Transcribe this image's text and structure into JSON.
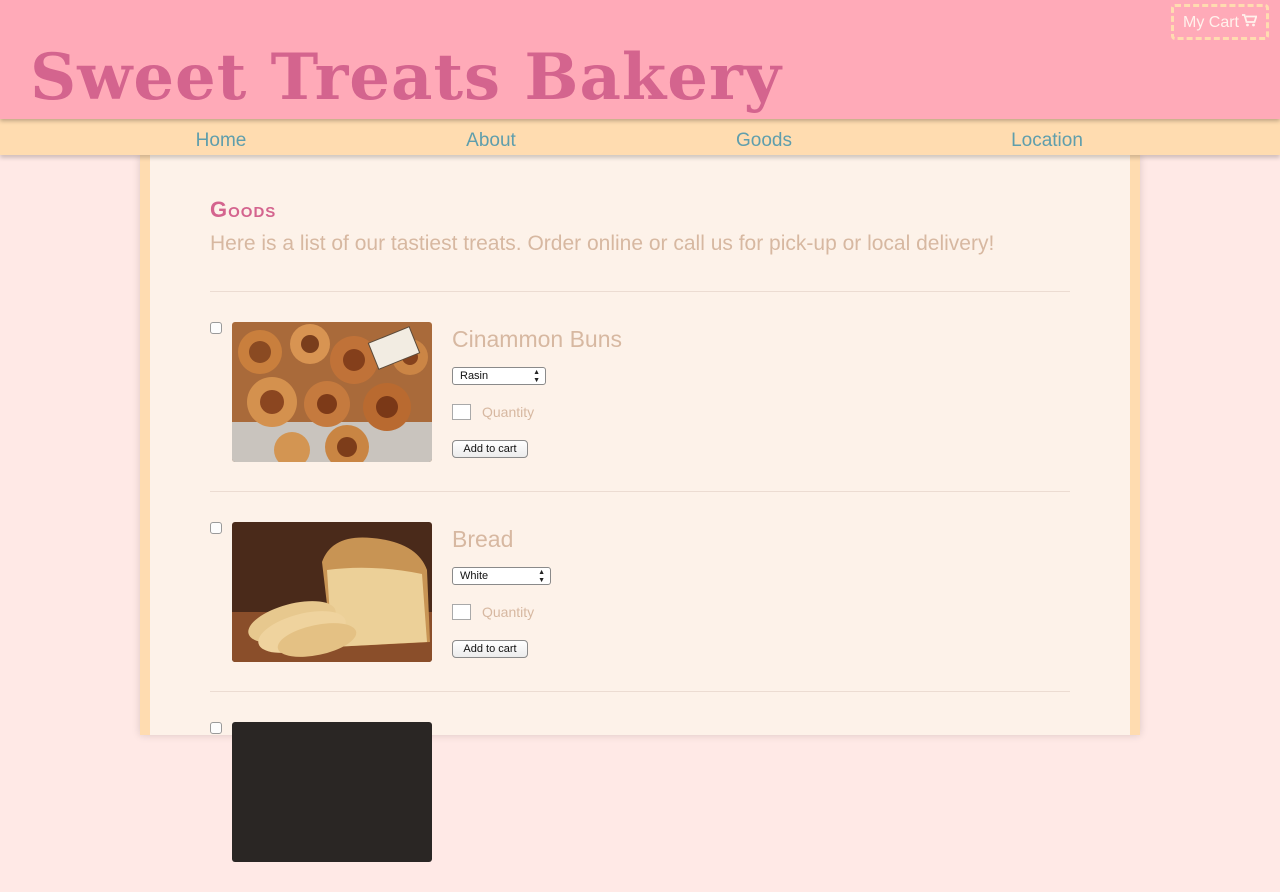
{
  "header": {
    "title": "Sweet Treats Bakery",
    "cart_label": "My Cart",
    "cart_icon": "shopping-cart-icon"
  },
  "nav": {
    "items": [
      {
        "label": "Home"
      },
      {
        "label": "About"
      },
      {
        "label": "Goods"
      },
      {
        "label": "Location"
      }
    ]
  },
  "colors": {
    "header_bg": "#ffaab8",
    "title": "#d4648e",
    "nav_bg": "#ffdcb0",
    "nav_text": "#5f9eac",
    "content_bg": "#fdf2e9",
    "muted_text": "#d7b8a1"
  },
  "goods": {
    "title": "Goods",
    "intro": "Here is a list of our tastiest treats. Order online or call us for pick-up or local delivery!",
    "products": [
      {
        "name": "Cinammon Buns",
        "selected_option": "Rasin",
        "quantity_label": "Quantity",
        "quantity_value": "",
        "add_label": "Add to cart",
        "image": "cinnamon-buns-photo"
      },
      {
        "name": "Bread",
        "selected_option": "White",
        "quantity_label": "Quantity",
        "quantity_value": "",
        "add_label": "Add to cart",
        "image": "bread-loaf-photo"
      }
    ]
  }
}
